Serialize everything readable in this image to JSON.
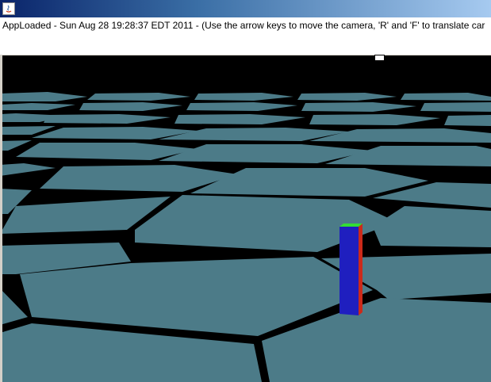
{
  "window": {
    "icon": "java-applet-icon"
  },
  "status": {
    "text": "AppLoaded - Sun Aug 28 19:28:37 EDT 2011 - (Use the arrow keys to move the camera, 'R' and 'F' to translate car"
  },
  "scene": {
    "ground_color": "#4c7b88",
    "gap_color": "#000000",
    "marker_colors": {
      "front": "#1f1fbf",
      "side": "#cc2a1a",
      "top": "#33dd33"
    }
  }
}
